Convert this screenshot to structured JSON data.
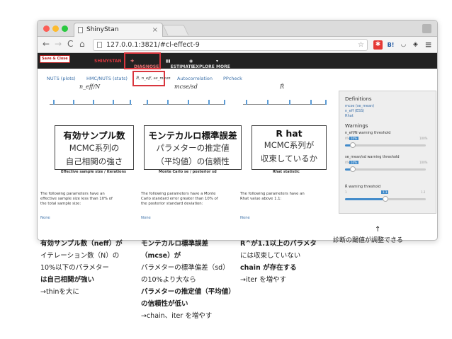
{
  "browser": {
    "tab_title": "ShinyStan",
    "tab_close": "×",
    "url": "127.0.0.1:3821/#cl-effect-9",
    "back": "←",
    "forward": "→",
    "reload": "C",
    "home": "⌂",
    "menu": "≡",
    "star": "☆",
    "bookmark_b": "B!"
  },
  "app": {
    "save_close": "Save & Close",
    "brand": "SHINYSTAN",
    "nav": [
      "DIAGNOSE",
      "ESTIMATE",
      "EXPLORE",
      "MORE"
    ]
  },
  "subtabs": [
    "NUTS (plots)",
    "HMC/NUTS (stats)",
    "R̂, n_eff, se_mean",
    "Autocorrelation",
    "PPcheck"
  ],
  "columns": [
    {
      "header": "n_eff/N",
      "caption": "Effective sample size / iterations",
      "note": "The following parameters have an effective sample size less than 10% of the total sample size:",
      "none": "None"
    },
    {
      "header": "mcse/sd",
      "caption": "Monte Carlo se / posterior sd",
      "note": "The following parameters have a Monte Carlo standard error greater than 10% of the posterior standard deviation:",
      "none": "None"
    },
    {
      "header": "R̂",
      "caption": "Rhat statistic",
      "note": "The following parameters have an Rhat value above 1.1:",
      "none": "None"
    }
  ],
  "callouts": [
    {
      "title": "有効サンプル数",
      "l1": "MCMC系列の",
      "l2": "自己相関の強さ"
    },
    {
      "title": "モンテカルロ標準誤差",
      "l1": "パラメターの推定値",
      "l2": "（平均値）の信頼性"
    },
    {
      "title": "R hat",
      "l1": "MCMC系列が",
      "l2": "収束しているか"
    }
  ],
  "sidebar": {
    "definitions_title": "Definitions",
    "definitions": [
      "mcse (se_mean)",
      "n_eff (ESS)",
      "Rhat"
    ],
    "warnings_title": "Warnings",
    "neff_label": "n_eff/N warning threshold",
    "neff_value": "10%",
    "neff_min": "0%",
    "neff_max": "100%",
    "neff_level": 0.1,
    "mcse_label": "se_mean/sd warning threshold",
    "mcse_value": "10%",
    "mcse_min": "0%",
    "mcse_max": "100%",
    "mcse_level": 0.1,
    "rhat_label": "R̂ warning threshold",
    "rhat_value": "1.1",
    "rhat_min": "1",
    "rhat_max": "1.2",
    "rhat_level": 0.5
  },
  "annotations": {
    "arrow": "↑",
    "threshold_note": "診断の閾値が調整できる",
    "neff": [
      "有効サンプル数（neff）が",
      "イテレーション数（N）の",
      "10%以下のパラメター",
      "は自己相関が強い",
      "→thinを大に"
    ],
    "mcse": [
      "モンテカルロ標準誤差",
      "（mcse）が",
      "パラメターの標準偏差（sd）",
      "の10%より大なら",
      "パラメターの推定値（平均値）",
      "の信頼性が低い",
      "→chain、iter を増やす"
    ],
    "rhat": [
      "R^が1.1以上のパラメタ",
      "には収束していない",
      "chain が存在する",
      "→iter を増やす"
    ]
  }
}
